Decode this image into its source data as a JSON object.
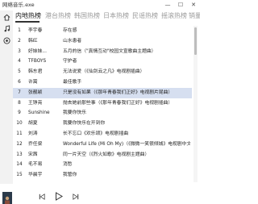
{
  "window": {
    "title": "网络音乐.exe",
    "minimize": "—",
    "maximize": "☐",
    "close": "✕"
  },
  "sidebar": {
    "items": [
      "home-icon",
      "music-note-icon",
      "record-icon"
    ],
    "settings": "gear-icon"
  },
  "tabs": [
    {
      "label": "内地热榜",
      "active": true
    },
    {
      "label": "港台热榜",
      "active": false
    },
    {
      "label": "韩国热榜",
      "active": false
    },
    {
      "label": "日本热榜",
      "active": false
    },
    {
      "label": "民谣热榜",
      "active": false
    },
    {
      "label": "摇滚热榜",
      "active": false
    },
    {
      "label": "销量热",
      "active": false
    }
  ],
  "songs": [
    {
      "num": "1",
      "artist": "李宇春",
      "title": "存在感"
    },
    {
      "num": "2",
      "artist": "韩红",
      "title": "山水患者"
    },
    {
      "num": "3",
      "artist": "好妹妹...",
      "title": "五月的信（\"真情互动\"校园文宣歌曲主题曲）"
    },
    {
      "num": "4",
      "artist": "TFBOYS",
      "title": "守护者"
    },
    {
      "num": "5",
      "artist": "韩东君",
      "title": "无法说爱（《仙剑云之凡》电视剧插曲）"
    },
    {
      "num": "6",
      "artist": "许嵩",
      "title": "最佳歌手"
    },
    {
      "num": "7",
      "artist": "张靓颖",
      "title": "只是没有如果（《那年青春我们正好》电视剧片尾曲）"
    },
    {
      "num": "8",
      "artist": "王铮亮",
      "title": "抛去她前那些事（《那年青春我们正好》电视剧插曲）"
    },
    {
      "num": "9",
      "artist": "Sunshine",
      "title": "我要你快乐"
    },
    {
      "num": "10",
      "artist": "胡夏",
      "title": "我要你快乐在开到你"
    },
    {
      "num": "11",
      "artist": "刘涛",
      "title": "长不忘口《欢乐颂》电视剧插曲"
    },
    {
      "num": "12",
      "artist": "乔任梁",
      "title": "Wonderful Life (Mi Oh My)（《微微一笑很倾城》电视剧中文推广曲）"
    },
    {
      "num": "13",
      "artist": "宋茜",
      "title": "同一片天空（《烈火如歌》电视剧主题曲）"
    },
    {
      "num": "14",
      "artist": "毛不易",
      "title": "消愁"
    },
    {
      "num": "15",
      "artist": "华晨宇",
      "title": "我管你"
    }
  ],
  "highlighted_index": 6,
  "player": {
    "prev": "previous-icon",
    "play": "play-icon",
    "next": "next-icon"
  }
}
